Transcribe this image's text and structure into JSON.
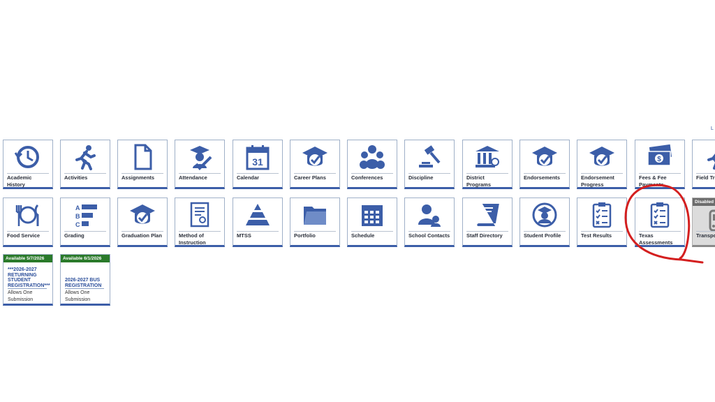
{
  "top_link": "L",
  "row1": [
    {
      "label": "Academic History",
      "icon": "history-clock-icon"
    },
    {
      "label": "Activities",
      "icon": "running-person-icon"
    },
    {
      "label": "Assignments",
      "icon": "document-icon"
    },
    {
      "label": "Attendance",
      "icon": "graduate-check-icon"
    },
    {
      "label": "Calendar",
      "icon": "calendar-icon",
      "day": "31"
    },
    {
      "label": "Career Plans",
      "icon": "grad-cap-check-icon"
    },
    {
      "label": "Conferences",
      "icon": "people-group-icon"
    },
    {
      "label": "Discipline",
      "icon": "gavel-icon"
    },
    {
      "label": "District Programs",
      "icon": "building-certificate-icon"
    },
    {
      "label": "Endorsements",
      "icon": "grad-cap-check-icon"
    },
    {
      "label": "Endorsement Progress",
      "icon": "grad-cap-check-icon"
    },
    {
      "label": "Fees & Fee Payments",
      "icon": "money-icon"
    },
    {
      "label": "Field Tri",
      "icon": "running-person-icon"
    }
  ],
  "row2": [
    {
      "label": "Food Service",
      "icon": "fork-plate-knife-icon"
    },
    {
      "label": "Grading",
      "icon": "grade-bars-icon",
      "letters": [
        "A",
        "B",
        "C"
      ]
    },
    {
      "label": "Graduation Plan",
      "icon": "grad-cap-check-icon"
    },
    {
      "label": "Method of Instruction",
      "icon": "certificate-doc-icon"
    },
    {
      "label": "MTSS",
      "icon": "pyramid-icon"
    },
    {
      "label": "Portfolio",
      "icon": "folder-icon"
    },
    {
      "label": "Schedule",
      "icon": "schedule-grid-icon"
    },
    {
      "label": "School Contacts",
      "icon": "contacts-icon"
    },
    {
      "label": "Staff Directory",
      "icon": "book-icon"
    },
    {
      "label": "Student Profile",
      "icon": "student-profile-icon"
    },
    {
      "label": "Test Results",
      "icon": "checklist-clipboard-icon"
    },
    {
      "label": "Texas Assessments",
      "icon": "checklist-clipboard-icon"
    },
    {
      "label": "Transpo",
      "icon": "bus-icon",
      "disabled": "Disabled"
    }
  ],
  "forms": [
    {
      "available": "Available 5/7/2026",
      "title": "***2026-2027 RETURNING STUDENT REGISTRATION***",
      "note": "Allows One Submission"
    },
    {
      "available": "Available 6/1/2026",
      "title": "2026-2027 BUS REGISTRATION",
      "note": "Allows One Submission"
    }
  ],
  "colors": {
    "icon": "#3c5ea8",
    "available": "#2a7a2a",
    "annotation": "#d41f1f"
  }
}
